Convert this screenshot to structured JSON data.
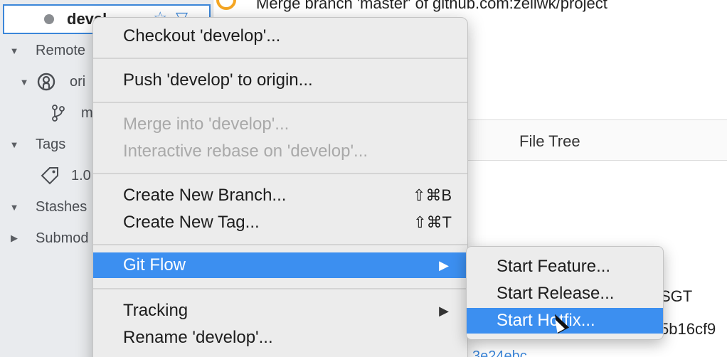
{
  "sidebar": {
    "selected_branch": "devel",
    "items": [
      {
        "label": "Remote"
      },
      {
        "label": "ori"
      },
      {
        "label": "m"
      },
      {
        "label": "Tags"
      },
      {
        "label": "1.0"
      },
      {
        "label": "Stashes"
      },
      {
        "label": "Submod"
      }
    ]
  },
  "main": {
    "commit_message": "Merge branch 'master' of github.com:zellwk/project",
    "file_tree_tab": "File Tree",
    "date_fragment": "SGT",
    "hash_fragment": "5b16cf9",
    "link_fragment": "3e24ebc"
  },
  "context_menu": {
    "checkout": "Checkout 'develop'...",
    "push": "Push 'develop' to origin...",
    "merge": "Merge into 'develop'...",
    "rebase": "Interactive rebase on 'develop'...",
    "new_branch": "Create New Branch...",
    "new_branch_shortcut": "⇧⌘B",
    "new_tag": "Create New Tag...",
    "new_tag_shortcut": "⇧⌘T",
    "git_flow": "Git Flow",
    "tracking": "Tracking",
    "rename": "Rename 'develop'..."
  },
  "git_flow_submenu": {
    "start_feature": "Start Feature...",
    "start_release": "Start Release...",
    "start_hotfix": "Start Hotfix..."
  },
  "colors": {
    "highlight": "#3c8ff0",
    "selection_border": "#3b86d9",
    "commit_node": "#f5a623"
  }
}
